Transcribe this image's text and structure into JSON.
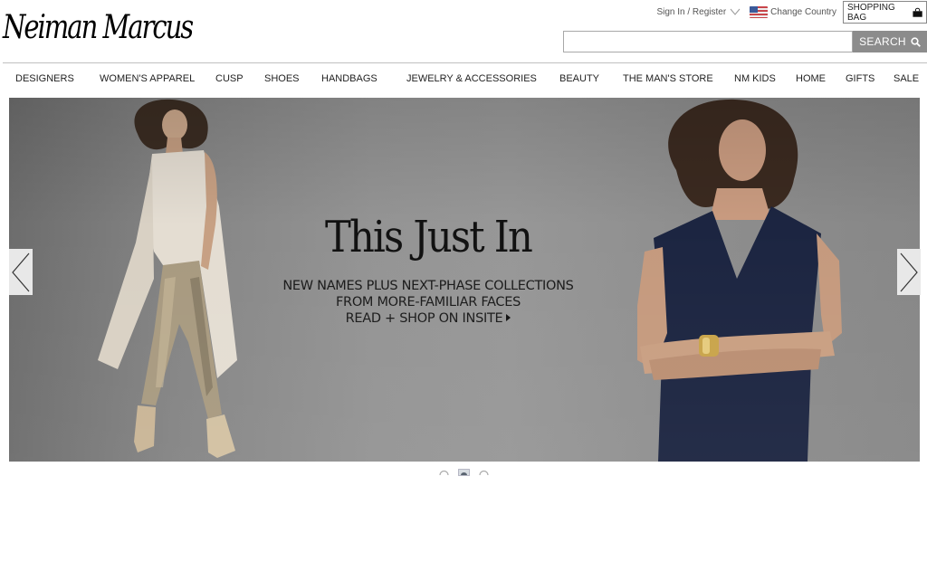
{
  "header": {
    "logo_text": "Neiman Marcus",
    "sign_in_label": "Sign In / Register",
    "change_country_label": "Change Country",
    "shopping_bag_label": "SHOPPING BAG",
    "search": {
      "value": "",
      "placeholder": "",
      "button_label": "SEARCH"
    }
  },
  "nav": {
    "items": [
      {
        "label": "DESIGNERS"
      },
      {
        "label": "WOMEN'S APPAREL"
      },
      {
        "label": "CUSP"
      },
      {
        "label": "SHOES"
      },
      {
        "label": "HANDBAGS"
      },
      {
        "label": "JEWELRY & ACCESSORIES"
      },
      {
        "label": "BEAUTY"
      },
      {
        "label": "THE MAN'S STORE"
      },
      {
        "label": "NM KIDS"
      },
      {
        "label": "HOME"
      },
      {
        "label": "GIFTS"
      },
      {
        "label": "SALE"
      }
    ]
  },
  "hero": {
    "title": "This Just In",
    "line1": "NEW NAMES PLUS NEXT-PHASE COLLECTIONS",
    "line2": "FROM MORE-FAMILIAR FACES",
    "line3": "READ + SHOP ON INSITE",
    "slide_count": 3,
    "active_slide": 2
  },
  "icons": {
    "chevron": "chevron-down-icon",
    "flag": "us-flag-icon",
    "bag": "shopping-bag-icon",
    "search": "search-icon",
    "prev": "chevron-left-icon",
    "next": "chevron-right-icon"
  },
  "colors": {
    "search_button": "#8c8c8c",
    "hero_background": "#949494",
    "text": "#222222"
  }
}
